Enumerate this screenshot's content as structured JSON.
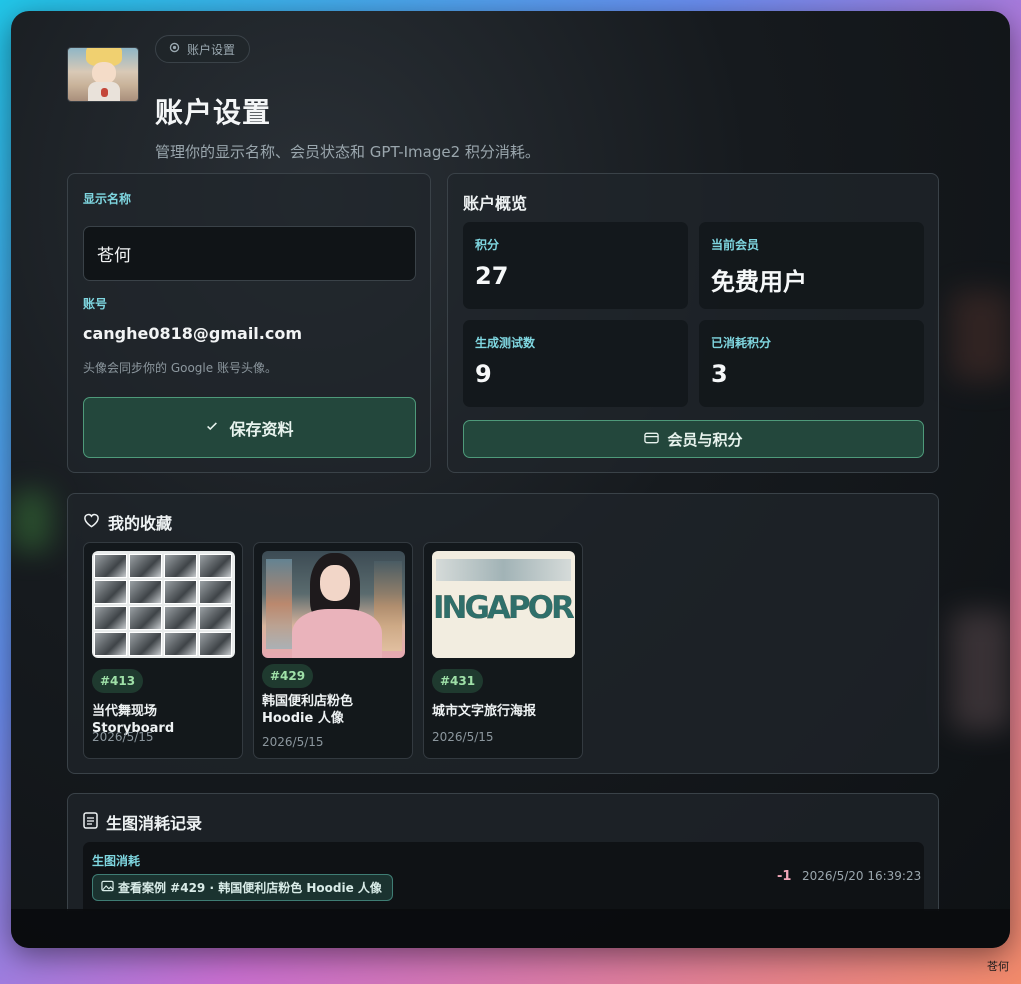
{
  "header": {
    "crumb_label": "账户设置",
    "title": "账户设置",
    "subtitle": "管理你的显示名称、会员状态和 GPT-Image2 积分消耗。"
  },
  "profile": {
    "display_name_label": "显示名称",
    "display_name_value": "苍何",
    "account_label": "账号",
    "email": "canghe0818@gmail.com",
    "avatar_hint": "头像会同步你的 Google 账号头像。",
    "save_label": "保存资料"
  },
  "overview": {
    "title": "账户概览",
    "stats": [
      {
        "label": "积分",
        "value": "27"
      },
      {
        "label": "当前会员",
        "value": "免费用户"
      },
      {
        "label": "生成测试数",
        "value": "9"
      },
      {
        "label": "已消耗积分",
        "value": "3"
      }
    ],
    "member_button": "会员与积分"
  },
  "favorites": {
    "title": "我的收藏",
    "items": [
      {
        "tag": "#413",
        "title": "当代舞现场 Storyboard",
        "date": "2026/5/15"
      },
      {
        "tag": "#429",
        "title": "韩国便利店粉色 Hoodie 人像",
        "date": "2026/5/15"
      },
      {
        "tag": "#431",
        "title": "城市文字旅行海报",
        "date": "2026/5/15"
      }
    ],
    "poster_text": "INGAPOR"
  },
  "usage": {
    "title": "生图消耗记录",
    "records": [
      {
        "type": "生图消耗",
        "case": "查看案例 #429 · 韩国便利店粉色 Hoodie 人像",
        "amount": "-1",
        "time": "2026/5/20 16:39:23"
      }
    ]
  },
  "dock": {
    "username": "苍何"
  },
  "colors": {
    "accent": "#7fd6e0",
    "button_bg": "#23473c",
    "button_border": "#4e9a7a",
    "tag_text": "#9fe0a8"
  }
}
